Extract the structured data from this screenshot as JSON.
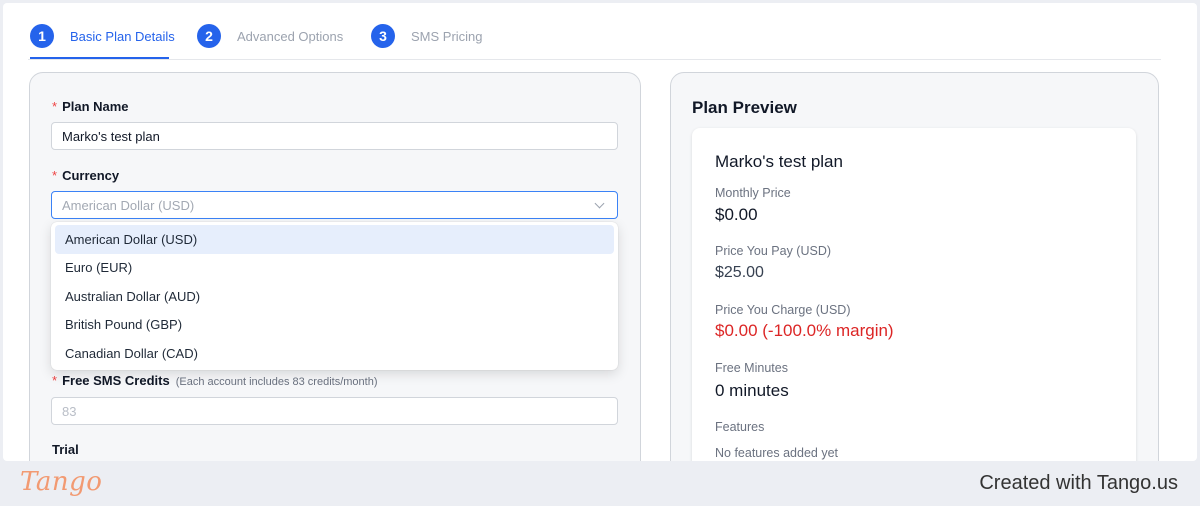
{
  "steps": [
    {
      "number": "1",
      "label": "Basic Plan Details"
    },
    {
      "number": "2",
      "label": "Advanced Options"
    },
    {
      "number": "3",
      "label": "SMS Pricing"
    }
  ],
  "active_step": 1,
  "form": {
    "plan_name": {
      "required_mark": "*",
      "label": "Plan Name",
      "value": "Marko's test plan"
    },
    "currency": {
      "required_mark": "*",
      "label": "Currency",
      "placeholder": "American Dollar (USD)"
    },
    "currency_options": [
      {
        "label": "American Dollar (USD)",
        "selected": true
      },
      {
        "label": "Euro (EUR)",
        "selected": false
      },
      {
        "label": "Australian Dollar (AUD)",
        "selected": false
      },
      {
        "label": "British Pound (GBP)",
        "selected": false
      },
      {
        "label": "Canadian Dollar (CAD)",
        "selected": false
      }
    ],
    "free_sms": {
      "required_mark": "*",
      "label": "Free SMS Credits",
      "hint": "(Each account includes 83 credits/month)",
      "placeholder": "83"
    },
    "trial": {
      "label": "Trial"
    }
  },
  "preview": {
    "title": "Plan Preview",
    "plan_name": "Marko's test plan",
    "monthly_price_label": "Monthly Price",
    "monthly_price": "$0.00",
    "price_you_pay_label": "Price You Pay (USD)",
    "price_you_pay": "$25.00",
    "price_you_charge_label": "Price You Charge (USD)",
    "price_you_charge": "$0.00 (-100.0% margin)",
    "free_minutes_label": "Free Minutes",
    "free_minutes": "0 minutes",
    "features_label": "Features",
    "features_value": "No features added yet"
  },
  "footer": {
    "logo": "Tango",
    "credit": "Created with Tango.us"
  },
  "colors": {
    "accent": "#2563eb",
    "danger": "#dc2626",
    "brand": "#f29a72"
  }
}
